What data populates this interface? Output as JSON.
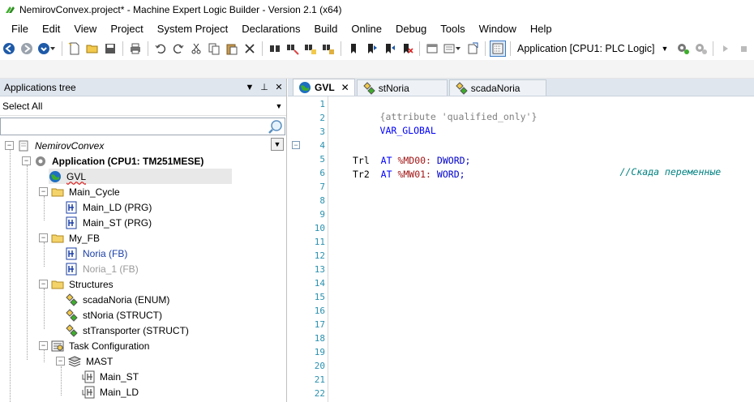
{
  "window": {
    "title": "NemirovConvex.project* - Machine Expert Logic Builder - Version 2.1 (x64)"
  },
  "menu": {
    "items": [
      {
        "label": "File"
      },
      {
        "label": "Edit"
      },
      {
        "label": "View"
      },
      {
        "label": "Project"
      },
      {
        "label": "System Project"
      },
      {
        "label": "Declarations"
      },
      {
        "label": "Build"
      },
      {
        "label": "Online"
      },
      {
        "label": "Debug"
      },
      {
        "label": "Tools"
      },
      {
        "label": "Window"
      },
      {
        "label": "Help"
      }
    ]
  },
  "toolbar": {
    "active_application": "Application [CPU1: PLC Logic]"
  },
  "applications_tree": {
    "header": "Applications tree",
    "filter": "Select All",
    "search_placeholder": "",
    "nodes": {
      "root": "NemirovConvex",
      "application": "Application (CPU1: TM251MESE)",
      "gvl": "GVL",
      "main_cycle": "Main_Cycle",
      "main_ld": "Main_LD (PRG)",
      "main_st": "Main_ST (PRG)",
      "my_fb": "My_FB",
      "noria": "Noria (FB)",
      "noria_1": "Noria_1 (FB)",
      "structures": "Structures",
      "scada_noria": "scadaNoria (ENUM)",
      "st_noria": "stNoria (STRUCT)",
      "st_transporter": "stTransporter (STRUCT)",
      "task_configuration": "Task Configuration",
      "mast": "MAST",
      "mast_main_st": "Main_ST",
      "mast_main_ld": "Main_LD"
    }
  },
  "editor": {
    "tabs": [
      {
        "label": "GVL",
        "active": true,
        "closable": true
      },
      {
        "label": "stNoria",
        "active": false
      },
      {
        "label": "scadaNoria",
        "active": false
      }
    ],
    "line_numbers": [
      "1",
      "2",
      "3",
      "4",
      "5",
      "6",
      "7",
      "8",
      "9",
      "10",
      "11",
      "12",
      "13",
      "14",
      "15",
      "16",
      "17",
      "18",
      "19",
      "20",
      "21",
      "22"
    ],
    "code": {
      "attribute": "{attribute 'qualified_only'}",
      "var_global": "VAR_GLOBAL",
      "line5": {
        "name": "Trl",
        "at": "AT",
        "address": "%MD00:",
        "type": "DWORD;",
        "comment": "//Скада переменные"
      },
      "line6": {
        "name": "Tr2",
        "at": "AT",
        "address": "%MW01:",
        "type": "WORD;"
      }
    }
  },
  "colors": {
    "panel_header": "#dfe6ee",
    "keyword": "#0000ff",
    "comment": "#008080",
    "line_number": "#2b91af"
  }
}
